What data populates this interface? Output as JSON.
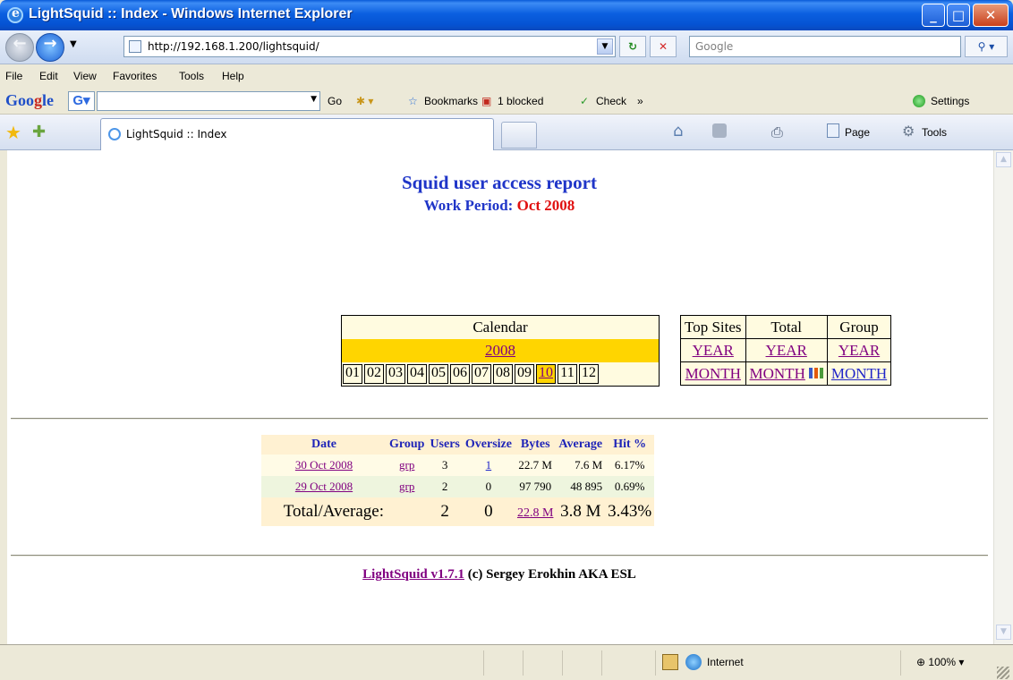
{
  "window": {
    "title": "LightSquid :: Index - Windows Internet Explorer"
  },
  "address": {
    "url": "http://192.168.1.200/lightsquid/",
    "search_placeholder": "Google"
  },
  "menu": [
    "File",
    "Edit",
    "View",
    "Favorites",
    "Tools",
    "Help"
  ],
  "google_toolbar": {
    "go": "Go",
    "bookmarks": "Bookmarks",
    "blocked": "1 blocked",
    "check": "Check",
    "settings": "Settings"
  },
  "tab": {
    "label": "LightSquid :: Index"
  },
  "commands": {
    "page": "Page",
    "tools": "Tools"
  },
  "report": {
    "title": "Squid user access report",
    "period_label": "Work Period:",
    "period_value": "Oct 2008"
  },
  "calendar": {
    "header": "Calendar",
    "year": "2008",
    "months": [
      "01",
      "02",
      "03",
      "04",
      "05",
      "06",
      "07",
      "08",
      "09",
      "10",
      "11",
      "12"
    ],
    "current": "10"
  },
  "toplinks": {
    "headers": [
      "Top Sites",
      "Total",
      "Group"
    ],
    "year": "YEAR",
    "month": "MONTH"
  },
  "stats": {
    "headers": [
      "Date",
      "Group",
      "Users",
      "Oversize",
      "Bytes",
      "Average",
      "Hit %"
    ],
    "rows": [
      {
        "date": "30 Oct 2008",
        "group": "grp",
        "users": "3",
        "oversize": "1",
        "bytes": "22.7 M",
        "average": "7.6 M",
        "hit": "6.17%"
      },
      {
        "date": "29 Oct 2008",
        "group": "grp",
        "users": "2",
        "oversize": "0",
        "bytes": "97 790",
        "average": "48 895",
        "hit": "0.69%"
      }
    ],
    "total": {
      "label": "Total/Average:",
      "users": "2",
      "oversize": "0",
      "bytes": "22.8 M",
      "average": "3.8 M",
      "hit": "3.43%"
    }
  },
  "footer": {
    "link": "LightSquid v1.7.1",
    "text": " (c) Sergey Erokhin AKA ESL"
  },
  "status": {
    "zone": "Internet",
    "zoom": "100%"
  }
}
